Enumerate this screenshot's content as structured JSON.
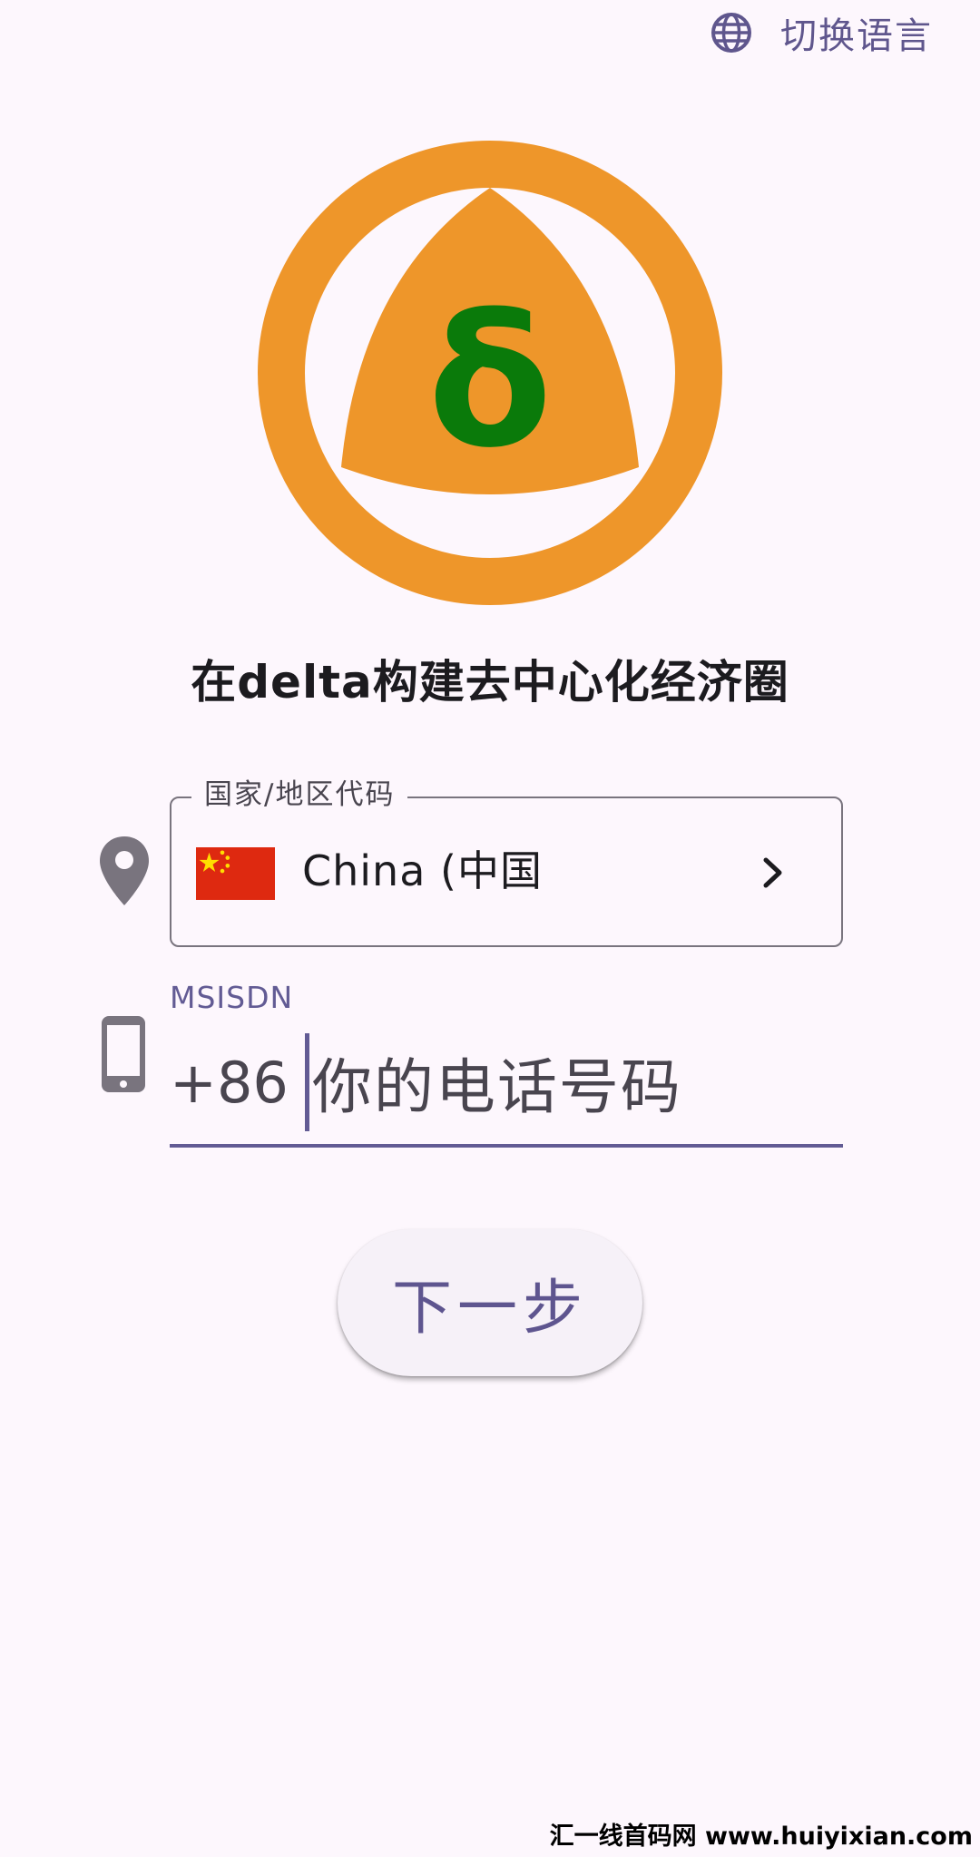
{
  "header": {
    "language_switch_label": "切换语言",
    "language_icon": "globe-icon"
  },
  "logo": {
    "glyph": "δ",
    "ring_color": "#EE962A",
    "glyph_color": "#0A7A0A"
  },
  "tagline": "在delta构建去中心化经济圈",
  "country_field": {
    "label": "国家/地区代码",
    "value": "China (中国",
    "flag_icon": "china-flag-icon",
    "leading_icon": "location-pin-icon",
    "trailing_icon": "chevron-right-icon"
  },
  "phone_field": {
    "label": "MSISDN",
    "prefix": "+86",
    "placeholder": "你的电话号码",
    "leading_icon": "smartphone-icon"
  },
  "next_button": {
    "label": "下一步"
  },
  "watermark": "汇一线首码网 www.huiyixian.com",
  "colors": {
    "background": "#FDF7FD",
    "accent": "#625B94",
    "outline": "#79747E"
  }
}
